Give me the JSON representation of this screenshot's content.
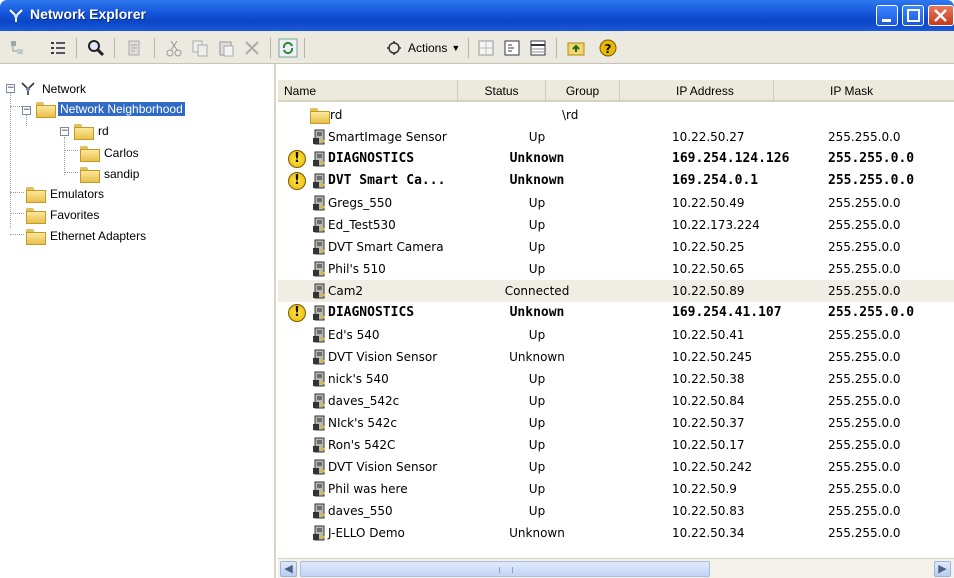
{
  "window": {
    "title": "Network Explorer"
  },
  "toolbar": {
    "actions_label": "Actions"
  },
  "tree": {
    "root": "Network",
    "network_neighborhood": "Network Neighborhood",
    "rd": "rd",
    "carlos": "Carlos",
    "sandip": "sandip",
    "emulators": "Emulators",
    "favorites": "Favorites",
    "ethernet_adapters": "Ethernet Adapters"
  },
  "list": {
    "columns": [
      "Name",
      "Status",
      "Group",
      "IP Address",
      "IP Mask"
    ],
    "rows": [
      {
        "name": "rd",
        "status": "",
        "group": "\\rd",
        "ip": "",
        "mask": "",
        "type": "folder"
      },
      {
        "name": "SmartImage Sensor",
        "status": "Up",
        "group": "",
        "ip": "10.22.50.27",
        "mask": "255.255.0.0"
      },
      {
        "name": "DIAGNOSTICS",
        "status": "Unknown",
        "group": "",
        "ip": "169.254.124.126",
        "mask": "255.255.0.0",
        "warn": true
      },
      {
        "name": "DVT Smart Ca...",
        "status": "Unknown",
        "group": "",
        "ip": "169.254.0.1",
        "mask": "255.255.0.0",
        "warn": true
      },
      {
        "name": "Gregs_550",
        "status": "Up",
        "group": "",
        "ip": "10.22.50.49",
        "mask": "255.255.0.0"
      },
      {
        "name": "Ed_Test530",
        "status": "Up",
        "group": "",
        "ip": "10.22.173.224",
        "mask": "255.255.0.0"
      },
      {
        "name": "DVT Smart Camera",
        "status": "Up",
        "group": "",
        "ip": "10.22.50.25",
        "mask": "255.255.0.0"
      },
      {
        "name": "Phil's 510",
        "status": "Up",
        "group": "",
        "ip": "10.22.50.65",
        "mask": "255.255.0.0"
      },
      {
        "name": "Cam2",
        "status": "Connected",
        "group": "",
        "ip": "10.22.50.89",
        "mask": "255.255.0.0",
        "highlight": true
      },
      {
        "name": "DIAGNOSTICS",
        "status": "Unknown",
        "group": "",
        "ip": "169.254.41.107",
        "mask": "255.255.0.0",
        "warn": true
      },
      {
        "name": "Ed's 540",
        "status": "Up",
        "group": "",
        "ip": "10.22.50.41",
        "mask": "255.255.0.0"
      },
      {
        "name": "DVT Vision Sensor",
        "status": "Unknown",
        "group": "",
        "ip": "10.22.50.245",
        "mask": "255.255.0.0"
      },
      {
        "name": "nick's 540",
        "status": "Up",
        "group": "",
        "ip": "10.22.50.38",
        "mask": "255.255.0.0"
      },
      {
        "name": "daves_542c",
        "status": "Up",
        "group": "",
        "ip": "10.22.50.84",
        "mask": "255.255.0.0"
      },
      {
        "name": "NIck's 542c",
        "status": "Up",
        "group": "",
        "ip": "10.22.50.37",
        "mask": "255.255.0.0"
      },
      {
        "name": "Ron's 542C",
        "status": "Up",
        "group": "",
        "ip": "10.22.50.17",
        "mask": "255.255.0.0"
      },
      {
        "name": "DVT Vision Sensor",
        "status": "Up",
        "group": "",
        "ip": "10.22.50.242",
        "mask": "255.255.0.0"
      },
      {
        "name": "Phil was here",
        "status": "Up",
        "group": "",
        "ip": "10.22.50.9",
        "mask": "255.255.0.0"
      },
      {
        "name": "daves_550",
        "status": "Up",
        "group": "",
        "ip": "10.22.50.83",
        "mask": "255.255.0.0"
      },
      {
        "name": "J-ELLO Demo",
        "status": "Unknown",
        "group": "",
        "ip": "10.22.50.34",
        "mask": "255.255.0.0"
      }
    ]
  }
}
